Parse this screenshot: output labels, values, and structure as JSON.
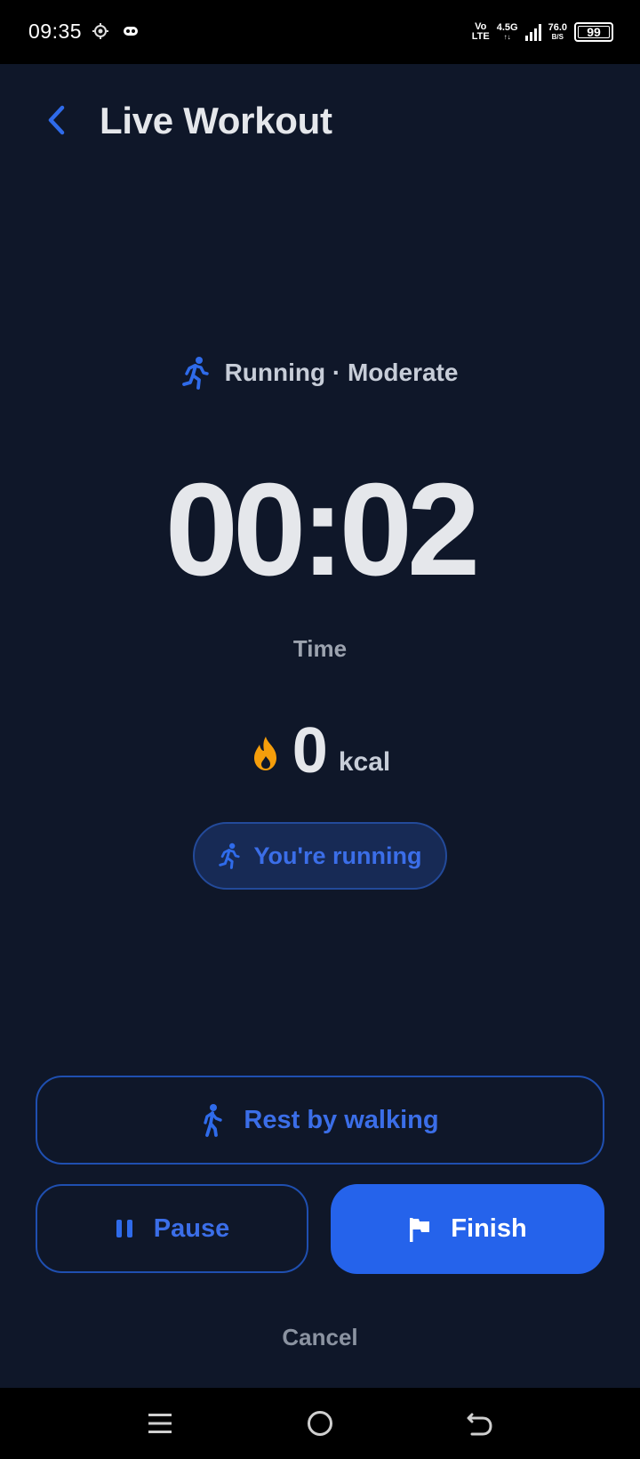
{
  "status_bar": {
    "time": "09:35",
    "net_top": "Vo",
    "net_bottom": "LTE",
    "gen_top": "4.5G",
    "gen_bottom": "↑↓",
    "speed_top": "76.0",
    "speed_bottom": "B/S",
    "battery": "99"
  },
  "header": {
    "title": "Live Workout",
    "back_icon": "chevron-left-icon"
  },
  "activity": {
    "label": "Running · Moderate",
    "icon": "running-person-icon"
  },
  "timer": {
    "value": "00:02",
    "label": "Time"
  },
  "calories": {
    "value": "0",
    "unit": "kcal",
    "icon": "flame-icon"
  },
  "state_pill": {
    "label": "You're running",
    "icon": "running-person-icon"
  },
  "buttons": {
    "rest_label": "Rest by walking",
    "pause_label": "Pause",
    "finish_label": "Finish",
    "cancel_label": "Cancel"
  },
  "colors": {
    "background": "#0f1729",
    "accent": "#2563eb",
    "accent_text": "#3b6ee8",
    "flame": "#f59e0b",
    "muted_text": "#9ca3af"
  }
}
